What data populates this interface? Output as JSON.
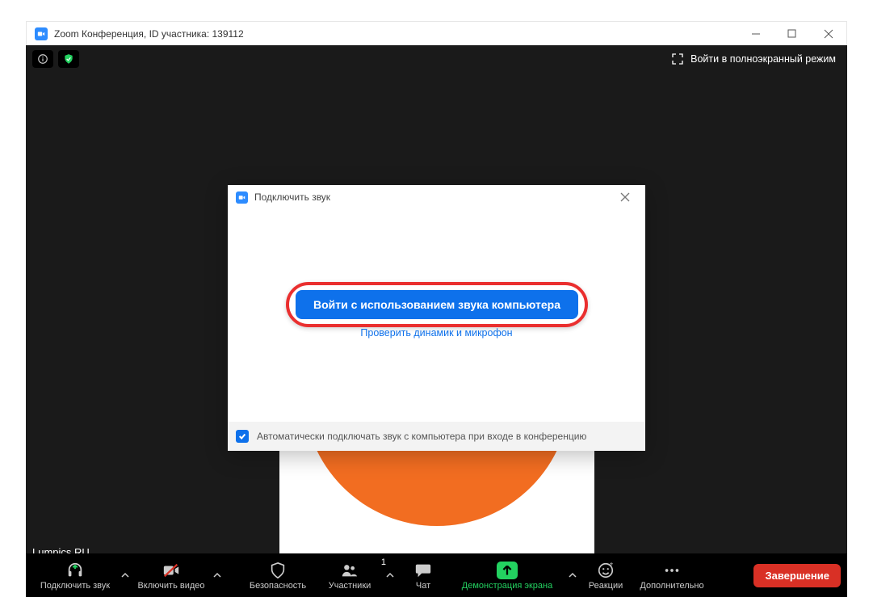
{
  "window": {
    "title": "Zoom Конференция, ID участника: 139112"
  },
  "topbar": {
    "fullscreen_label": "Войти в полноэкранный режим"
  },
  "participant": {
    "name": "Lumpics RU"
  },
  "modal": {
    "title": "Подключить звук",
    "primary_button": "Войти с использованием звука компьютера",
    "test_link": "Проверить динамик и микрофон",
    "footer_checkbox_label": "Автоматически подключать звук с компьютера при входе в конференцию"
  },
  "bottombar": {
    "join_audio": "Подключить звук",
    "start_video": "Включить видео",
    "security": "Безопасность",
    "participants": "Участники",
    "participants_count": "1",
    "chat": "Чат",
    "share_screen": "Демонстрация экрана",
    "reactions": "Реакции",
    "more": "Дополнительно",
    "end": "Завершение"
  },
  "colors": {
    "zoom_blue": "#2D8CFF",
    "primary_blue": "#0E71EB",
    "accent_green": "#23D160",
    "highlight_red": "#ea2f2f",
    "end_red": "#d93025",
    "avatar_orange": "#F26D21"
  }
}
